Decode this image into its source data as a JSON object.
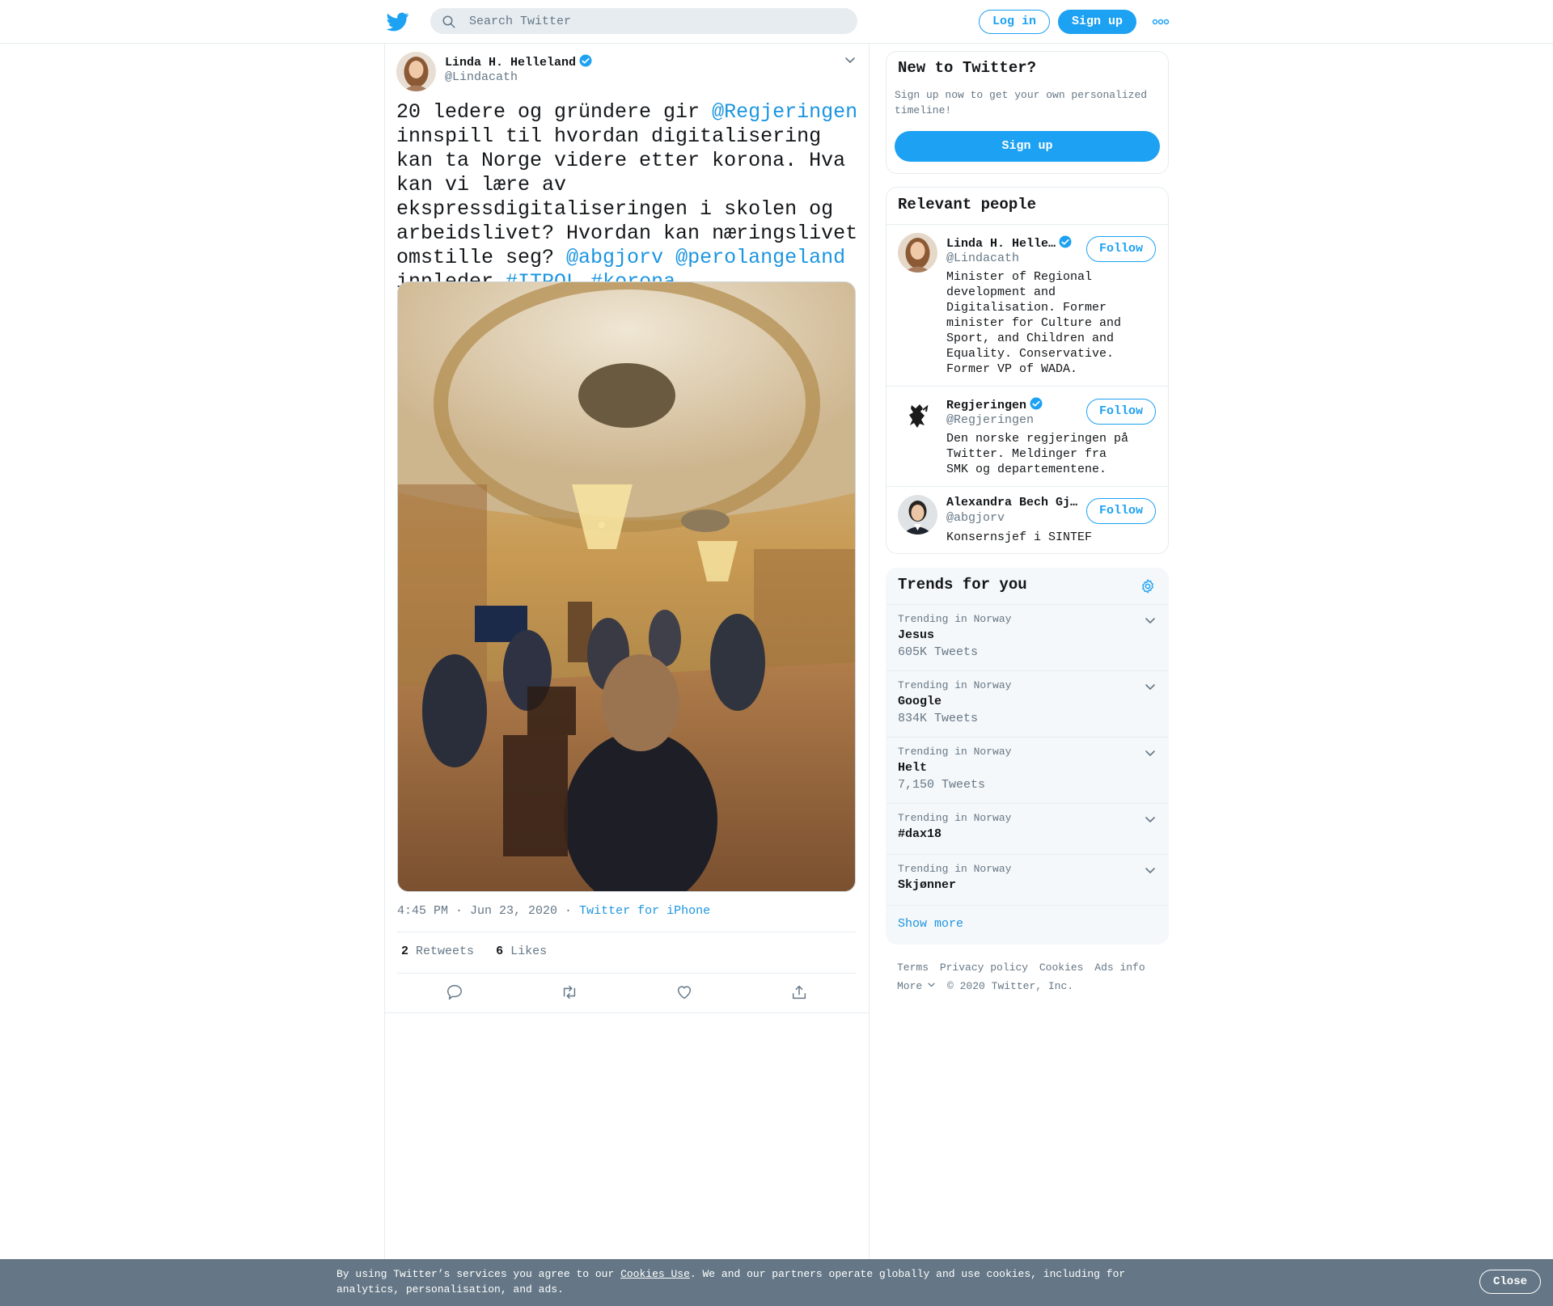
{
  "header": {
    "search_placeholder": "Search Twitter",
    "login_label": "Log in",
    "signup_label": "Sign up",
    "more_icon": "more-dots-icon",
    "brand_color": "#1da1f2"
  },
  "tweet": {
    "author_name": "Linda H. Helleland",
    "author_handle": "@Lindacath",
    "text_parts": {
      "t1": "20 ledere og gründere gir ",
      "m1": "@Regjeringen",
      "t2": " innspill til hvordan digitalisering kan ta Norge videre etter korona. Hva kan vi lære av ekspressdigitaliseringen i skolen og arbeidslivet? Hvordan kan næringslivet omstille seg? ",
      "m2": "@abgjorv",
      "t3": " ",
      "m3": "@perolangeland",
      "t4": " innleder ",
      "h1": "#ITPOL",
      "t5": " ",
      "h2": "#korona"
    },
    "time": "4:45 PM · Jun 23, 2020",
    "dot": " · ",
    "source": "Twitter for iPhone",
    "retweets_count": "2",
    "retweets_label": "Retweets",
    "likes_count": "6",
    "likes_label": "Likes"
  },
  "new_to_twitter": {
    "title": "New to Twitter?",
    "description": "Sign up now to get your own personalized timeline!",
    "button_label": "Sign up"
  },
  "relevant_people": {
    "title": "Relevant people",
    "follow_label": "Follow",
    "people": [
      {
        "name": "Linda H. Helle…",
        "handle": "@Lindacath",
        "bio": "Minister of Regional development and Digitalisation. Former minister for Culture and Sport, and Children and Equality. Conservative. Former VP of WADA."
      },
      {
        "name": "Regjeringen",
        "handle": "@Regjeringen",
        "bio": "Den norske regjeringen på Twitter. Meldinger fra SMK og departementene."
      },
      {
        "name": "Alexandra Bech Gj…",
        "handle": "@abgjorv",
        "bio": "Konsernsjef i SINTEF"
      }
    ]
  },
  "trends": {
    "title": "Trends for you",
    "items": [
      {
        "context": "Trending in Norway",
        "name": "Jesus",
        "count": "605K Tweets"
      },
      {
        "context": "Trending in Norway",
        "name": "Google",
        "count": "834K Tweets"
      },
      {
        "context": "Trending in Norway",
        "name": "Helt",
        "count": "7,150 Tweets"
      },
      {
        "context": "Trending in Norway",
        "name": "#dax18",
        "count": ""
      },
      {
        "context": "Trending in Norway",
        "name": "Skjønner",
        "count": ""
      }
    ],
    "show_more": "Show more"
  },
  "footer": {
    "links": [
      "Terms",
      "Privacy policy",
      "Cookies",
      "Ads info"
    ],
    "more": "More",
    "copyright": "© 2020 Twitter, Inc."
  },
  "cookie_banner": {
    "text_before": "By using Twitter’s services you agree to our ",
    "link": "Cookies Use",
    "text_after": ". We and our partners operate globally and use cookies, including for analytics, personalisation, and ads.",
    "close_label": "Close"
  }
}
